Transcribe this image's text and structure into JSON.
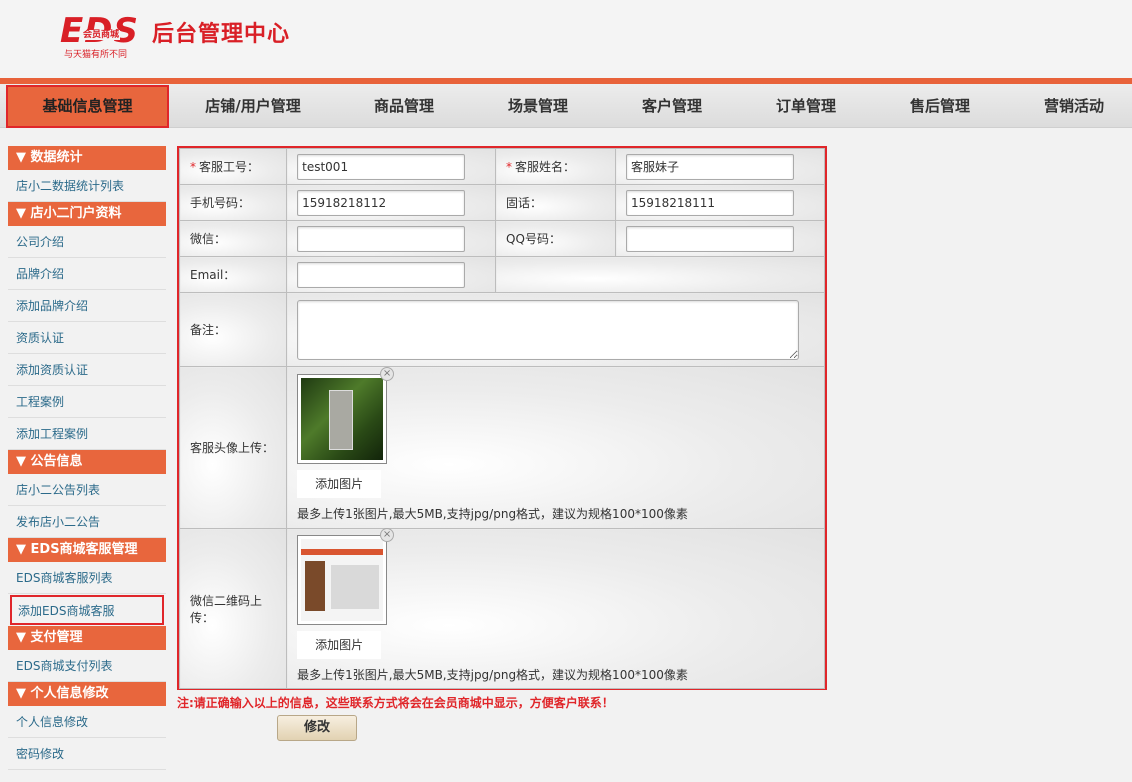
{
  "header": {
    "logo_text": "EDS",
    "logo_sub": "会员商城",
    "logo_tagline": "与天猫有所不同",
    "title": "后台管理中心"
  },
  "nav": {
    "items": [
      {
        "label": "基础信息管理",
        "active": true
      },
      {
        "label": "店铺/用户管理"
      },
      {
        "label": "商品管理"
      },
      {
        "label": "场景管理"
      },
      {
        "label": "客户管理"
      },
      {
        "label": "订单管理"
      },
      {
        "label": "售后管理"
      },
      {
        "label": "营销活动"
      }
    ]
  },
  "sidebar": {
    "groups": [
      {
        "title": "▼ 数据统计",
        "links": [
          "店小二数据统计列表"
        ]
      },
      {
        "title": "▼ 店小二门户资料",
        "links": [
          "公司介绍",
          "品牌介绍",
          "添加品牌介绍",
          "资质认证",
          "添加资质认证",
          "工程案例",
          "添加工程案例"
        ]
      },
      {
        "title": "▼ 公告信息",
        "links": [
          "店小二公告列表",
          "发布店小二公告"
        ]
      },
      {
        "title": "▼ EDS商城客服管理",
        "links": [
          "EDS商城客服列表",
          "添加EDS商城客服"
        ]
      },
      {
        "title": "▼ 支付管理",
        "links": [
          "EDS商城支付列表"
        ]
      },
      {
        "title": "▼ 个人信息修改",
        "links": [
          "个人信息修改",
          "密码修改"
        ]
      }
    ]
  },
  "form": {
    "staff_id": {
      "label": "客服工号：",
      "value": "test001",
      "required": "*"
    },
    "staff_name": {
      "label": "客服姓名：",
      "value": "客服妹子",
      "required": "*"
    },
    "mobile": {
      "label": "手机号码：",
      "value": "15918218112"
    },
    "phone": {
      "label": "固话：",
      "value": "15918218111"
    },
    "wechat": {
      "label": "微信：",
      "value": ""
    },
    "qq": {
      "label": "QQ号码：",
      "value": ""
    },
    "email": {
      "label": "Email：",
      "value": ""
    },
    "remark": {
      "label": "备注：",
      "value": ""
    },
    "avatar": {
      "label": "客服头像上传：",
      "add_label": "添加图片",
      "hint": "最多上传1张图片,最大5MB,支持jpg/png格式，建议为规格100*100像素"
    },
    "qrcode": {
      "label": "微信二维码上传：",
      "add_label": "添加图片",
      "hint": "最多上传1张图片,最大5MB,支持jpg/png格式，建议为规格100*100像素"
    },
    "close_glyph": "×"
  },
  "notice": "注:请正确输入以上的信息，这些联系方式将会在会员商城中显示，方便客户联系！",
  "submit_label": "修改",
  "colors": {
    "accent": "#e8663d",
    "highlight": "#e0262a",
    "brand": "#d91f26"
  }
}
